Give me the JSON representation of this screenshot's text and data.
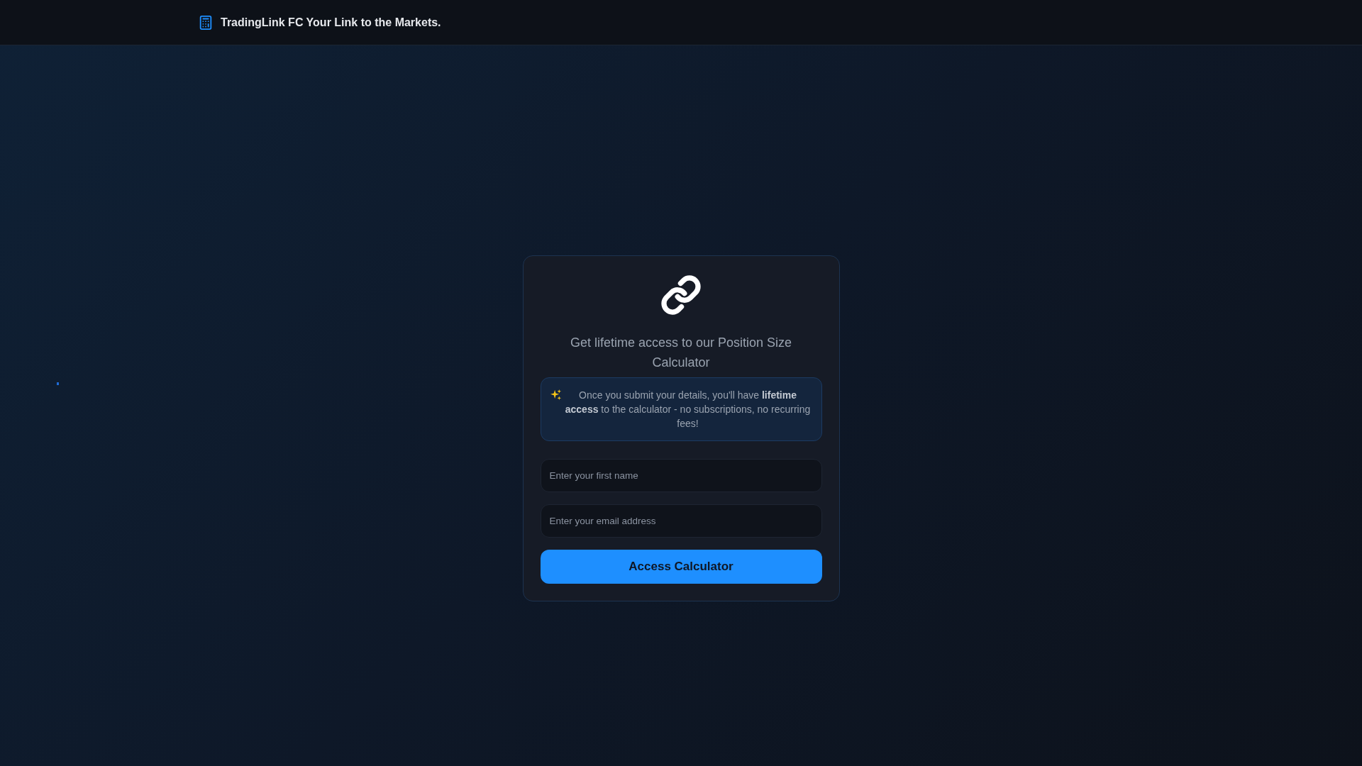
{
  "header": {
    "brand": "TradingLink FC Your Link to the Markets."
  },
  "card": {
    "heading": "Get lifetime access to our Position Size Calculator",
    "notice": "Once you submit your details, you'll have **lifetime access** to the calculator - no subscriptions, no recurring fees!",
    "fields": [
      {
        "placeholder": "Enter your first name"
      },
      {
        "placeholder": "Enter your email address"
      }
    ],
    "button": "Access Calculator"
  }
}
